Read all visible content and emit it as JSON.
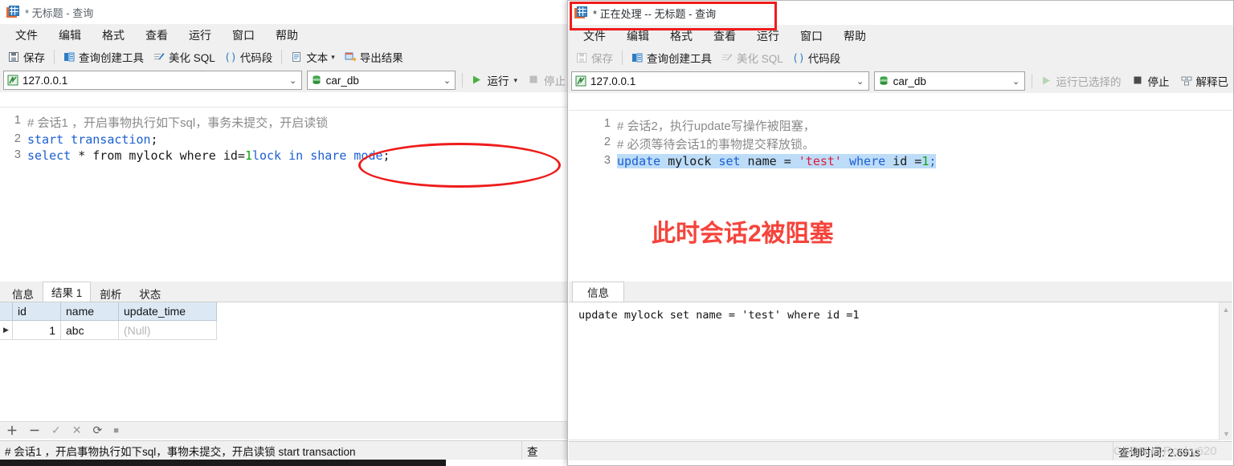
{
  "left_window": {
    "title": "* 无标题 - 查询",
    "icon": "navicat-query-icon",
    "menu": [
      "文件",
      "编辑",
      "格式",
      "查看",
      "运行",
      "窗口",
      "帮助"
    ],
    "toolbar": [
      {
        "label": "保存",
        "icon": "save-icon"
      },
      {
        "label": "查询创建工具",
        "icon": "query-builder-icon"
      },
      {
        "label": "美化 SQL",
        "icon": "beautify-sql-icon"
      },
      {
        "label": "代码段",
        "icon": "code-snippet-icon"
      },
      {
        "label": "文本",
        "icon": "text-icon"
      },
      {
        "label": "导出结果",
        "icon": "export-result-icon"
      }
    ],
    "connection": "127.0.0.1",
    "database": "car_db",
    "run_label": "运行",
    "stop_label": "停止",
    "editor_lines": [
      {
        "n": "1",
        "comment": "# 会话1 ，开启事物执行如下sql，事务未提交，开启读锁"
      },
      {
        "n": "2",
        "kw1": "start transaction",
        "tail": ";"
      },
      {
        "n": "3",
        "select": "select",
        "rest": " * from mylock where id=",
        "one": "1",
        "lock": "lock in share mode",
        "semi": ";"
      }
    ],
    "result_tabs": [
      "信息",
      "结果 1",
      "剖析",
      "状态"
    ],
    "active_result_tab": "结果 1",
    "grid": {
      "columns": [
        "id",
        "name",
        "update_time"
      ],
      "rows": [
        [
          "1",
          "abc",
          "(Null)"
        ]
      ]
    },
    "record_toolbar": [
      "plus-icon",
      "minus-icon",
      "check-icon",
      "cross-icon",
      "refresh-icon",
      "stop-square-icon"
    ],
    "status_text": "# 会话1 ，开启事物执行如下sql，事物未提交，开启读锁 start transaction",
    "status_right": "查"
  },
  "right_window": {
    "title": "* 正在处理 -- 无标题 - 查询",
    "icon": "navicat-query-icon",
    "menu": [
      "文件",
      "编辑",
      "格式",
      "查看",
      "运行",
      "窗口",
      "帮助"
    ],
    "toolbar": [
      {
        "label": "保存",
        "icon": "save-icon"
      },
      {
        "label": "查询创建工具",
        "icon": "query-builder-icon"
      },
      {
        "label": "美化 SQL",
        "icon": "beautify-sql-icon"
      },
      {
        "label": "代码段",
        "icon": "code-snippet-icon"
      }
    ],
    "connection": "127.0.0.1",
    "database": "car_db",
    "run_selected_label": "运行已选择的",
    "stop_label": "停止",
    "explain_label": "解释已",
    "editor_lines": [
      {
        "n": "1",
        "comment": "# 会话2，执行update写操作被阻塞，"
      },
      {
        "n": "2",
        "comment": "# 必须等待会话1的事物提交释放锁。"
      },
      {
        "n": "3",
        "kw": "update",
        "t1": " mylock ",
        "kw2": "set",
        "t2": " name = ",
        "str": "'test'",
        "t3": " ",
        "kw3": "where",
        "t4": " id =",
        "num": "1",
        "semi": ";"
      }
    ],
    "annotation_red": "此时会话2被阻塞",
    "result_tabs": [
      "信息"
    ],
    "active_result_tab": "信息",
    "message": "update mylock set name = 'test' where id =1",
    "status_query_time": "查询时间: 2.691s"
  },
  "watermark": "CSDN @Rocky620",
  "colors": {
    "accent_red": "#ee1c1c",
    "annotation_red": "#f5443c",
    "keyword_blue": "#1b5fd0",
    "string_red": "#e01b3c",
    "number_green": "#10a010",
    "selection_blue": "#bcdcf8",
    "chrome_gray": "#f0f0f0",
    "header_blue": "#dce9f5"
  }
}
